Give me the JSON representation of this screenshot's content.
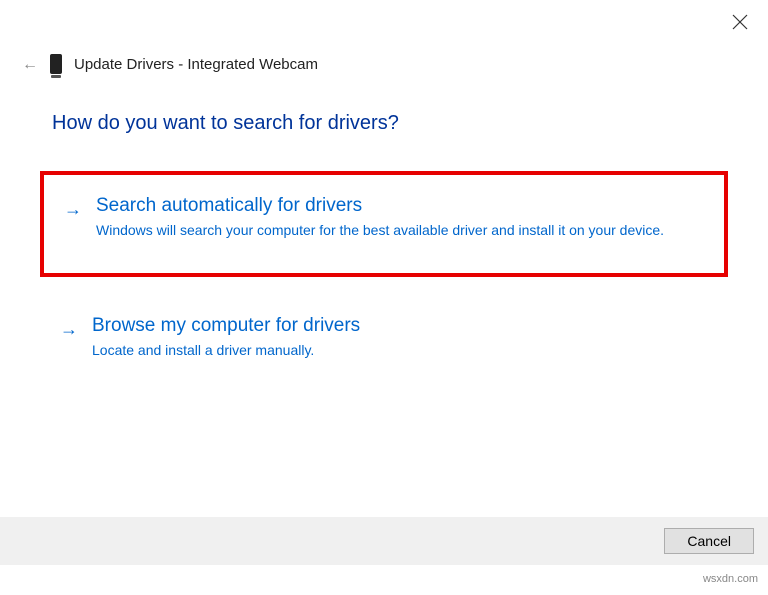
{
  "header": {
    "title": "Update Drivers - Integrated Webcam"
  },
  "question": "How do you want to search for drivers?",
  "options": [
    {
      "title": "Search automatically for drivers",
      "description": "Windows will search your computer for the best available driver and install it on your device."
    },
    {
      "title": "Browse my computer for drivers",
      "description": "Locate and install a driver manually."
    }
  ],
  "buttons": {
    "cancel": "Cancel"
  },
  "watermark": "wsxdn.com"
}
